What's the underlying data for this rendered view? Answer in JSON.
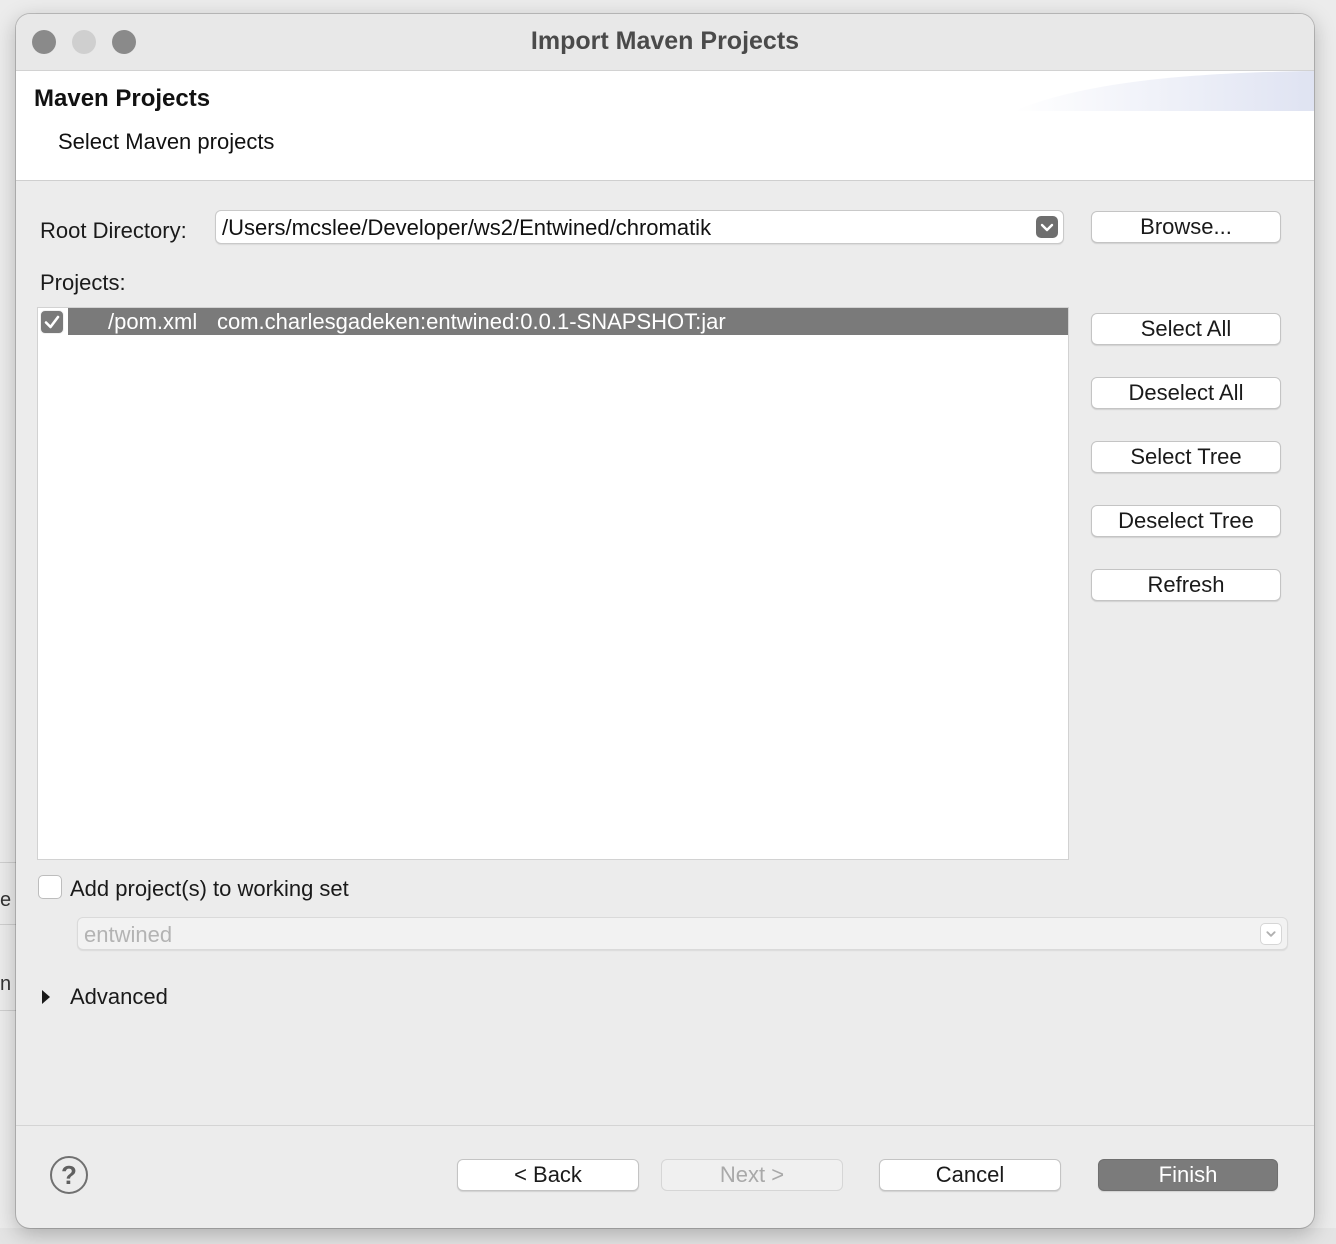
{
  "window": {
    "title": "Import Maven Projects"
  },
  "banner": {
    "title": "Maven Projects",
    "subtitle": "Select Maven projects"
  },
  "root_directory": {
    "label": "Root Directory:",
    "value": "/Users/mcslee/Developer/ws2/Entwined/chromatik",
    "browse_label": "Browse..."
  },
  "projects": {
    "label": "Projects:",
    "items": [
      {
        "checked": true,
        "path": "/pom.xml",
        "artifact": "com.charlesgadeken:entwined:0.0.1-SNAPSHOT:jar"
      }
    ]
  },
  "side_buttons": {
    "select_all": "Select All",
    "deselect_all": "Deselect All",
    "select_tree": "Select Tree",
    "deselect_tree": "Deselect Tree",
    "refresh": "Refresh"
  },
  "working_set": {
    "label": "Add project(s) to working set",
    "checked": false,
    "value": "entwined"
  },
  "advanced": {
    "label": "Advanced"
  },
  "footer": {
    "back": "< Back",
    "next": "Next >",
    "cancel": "Cancel",
    "finish": "Finish"
  },
  "background_fragments": [
    "e",
    "n"
  ]
}
